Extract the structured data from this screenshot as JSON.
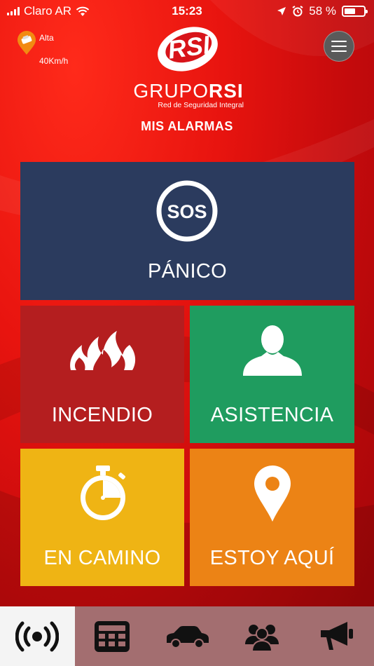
{
  "status_bar": {
    "carrier": "Claro AR",
    "time": "15:23",
    "battery_percent": "58 %",
    "battery_level": 0.58
  },
  "speed_widget": {
    "level": "Alta",
    "speed": "40Km/h"
  },
  "logo": {
    "mark_text": "RSI",
    "name_prefix": "GRUPO",
    "name_suffix": "RSI",
    "tagline": "Red de Seguridad Integral"
  },
  "section_title": "MIS ALARMAS",
  "tiles": {
    "panic": {
      "label": "PÁNICO",
      "icon_text": "SOS",
      "icon": "sos-icon",
      "color": "#2b3b5e"
    },
    "fire": {
      "label": "INCENDIO",
      "icon": "fire-icon",
      "color": "#b41e1f"
    },
    "assist": {
      "label": "ASISTENCIA",
      "icon": "person-icon",
      "color": "#1f9c5f"
    },
    "onway": {
      "label": "EN CAMINO",
      "icon": "stopwatch-icon",
      "color": "#efb414"
    },
    "here": {
      "label": "ESTOY AQUÍ",
      "icon": "map-pin-icon",
      "color": "#ec8315"
    }
  },
  "tab_bar": {
    "tabs": [
      {
        "icon": "broadcast-icon",
        "active": true
      },
      {
        "icon": "calculator-icon",
        "active": false
      },
      {
        "icon": "car-icon",
        "active": false
      },
      {
        "icon": "group-icon",
        "active": false
      },
      {
        "icon": "megaphone-icon",
        "active": false
      }
    ]
  }
}
